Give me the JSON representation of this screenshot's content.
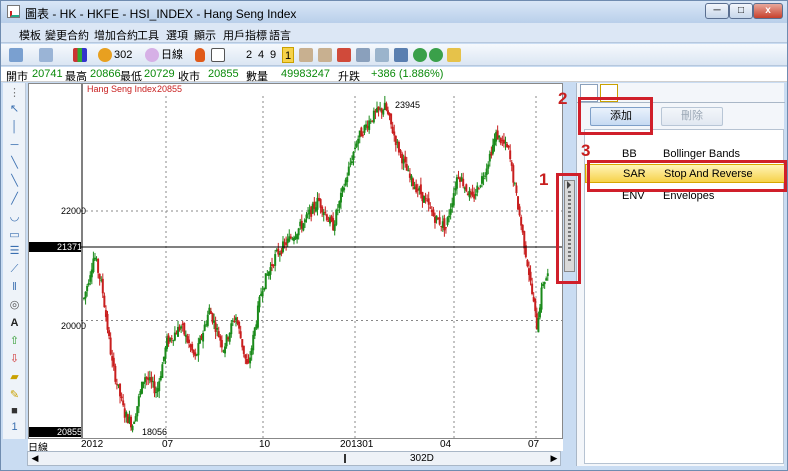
{
  "window": {
    "title": "圖表 - HK - HKFE - HSI_INDEX - Hang Seng Index",
    "min_label": "─",
    "max_label": "□",
    "close_label": "x"
  },
  "menu": [
    "模板",
    "變更合約",
    "增加合約",
    "工具",
    "選項",
    "顯示",
    "用戶指標",
    "語言"
  ],
  "toolbar": {
    "period": "302",
    "interval": "日線",
    "digits": [
      "2",
      "4",
      "9",
      "1"
    ]
  },
  "quote": {
    "open_label": "開市",
    "open": "20741",
    "high_label": "最高",
    "high": "20866",
    "low_label": "最低",
    "low": "20729",
    "close_label": "收市",
    "close": "20855",
    "volume_label": "數量",
    "volume": "49983247",
    "change_label": "升跌",
    "change": "+386 (1.886%)"
  },
  "chart_data": {
    "type": "candlestick",
    "title": "Hang Seng Index",
    "last_value": "20855",
    "y_ticks": [
      "22000",
      "20000"
    ],
    "price_line_label": "21371",
    "last_price_label": "20855",
    "annotations": [
      "23945",
      "18056"
    ],
    "x_ticks": [
      "2012",
      "07",
      "10",
      "201301",
      "04",
      "07"
    ],
    "period_label": "日線",
    "scroll_label": "302D",
    "ylim": [
      18000,
      24100
    ],
    "close_path": [
      {
        "t": 0,
        "v": 20400
      },
      {
        "t": 10,
        "v": 21200
      },
      {
        "t": 18,
        "v": 20600
      },
      {
        "t": 28,
        "v": 19200
      },
      {
        "t": 40,
        "v": 18300
      },
      {
        "t": 48,
        "v": 18100
      },
      {
        "t": 60,
        "v": 19000
      },
      {
        "t": 72,
        "v": 18700
      },
      {
        "t": 82,
        "v": 19600
      },
      {
        "t": 96,
        "v": 19900
      },
      {
        "t": 110,
        "v": 19300
      },
      {
        "t": 124,
        "v": 20200
      },
      {
        "t": 138,
        "v": 19500
      },
      {
        "t": 150,
        "v": 20100
      },
      {
        "t": 162,
        "v": 19100
      },
      {
        "t": 176,
        "v": 20600
      },
      {
        "t": 190,
        "v": 21200
      },
      {
        "t": 204,
        "v": 21500
      },
      {
        "t": 218,
        "v": 21800
      },
      {
        "t": 232,
        "v": 22200
      },
      {
        "t": 246,
        "v": 21700
      },
      {
        "t": 258,
        "v": 22500
      },
      {
        "t": 270,
        "v": 23300
      },
      {
        "t": 284,
        "v": 23700
      },
      {
        "t": 298,
        "v": 23900
      },
      {
        "t": 310,
        "v": 23200
      },
      {
        "t": 322,
        "v": 22600
      },
      {
        "t": 334,
        "v": 22300
      },
      {
        "t": 346,
        "v": 21900
      },
      {
        "t": 358,
        "v": 21700
      },
      {
        "t": 370,
        "v": 22700
      },
      {
        "t": 384,
        "v": 22200
      },
      {
        "t": 396,
        "v": 22700
      },
      {
        "t": 408,
        "v": 23400
      },
      {
        "t": 420,
        "v": 23100
      },
      {
        "t": 432,
        "v": 21800
      },
      {
        "t": 440,
        "v": 20900
      },
      {
        "t": 448,
        "v": 19900
      },
      {
        "t": 454,
        "v": 20700
      },
      {
        "t": 460,
        "v": 20855
      }
    ]
  },
  "panel": {
    "add_label": "添加",
    "delete_label": "刪除",
    "indicators": [
      {
        "code": "BB",
        "name": "Bollinger Bands"
      },
      {
        "code": "SAR",
        "name": "Stop And Reverse"
      },
      {
        "code": "ENV",
        "name": "Envelopes"
      }
    ]
  },
  "callouts": [
    "1",
    "2",
    "3"
  ],
  "colors": {
    "highlight": "#d01f2a",
    "up": "#1a8a1a",
    "down": "#c81e1e"
  }
}
